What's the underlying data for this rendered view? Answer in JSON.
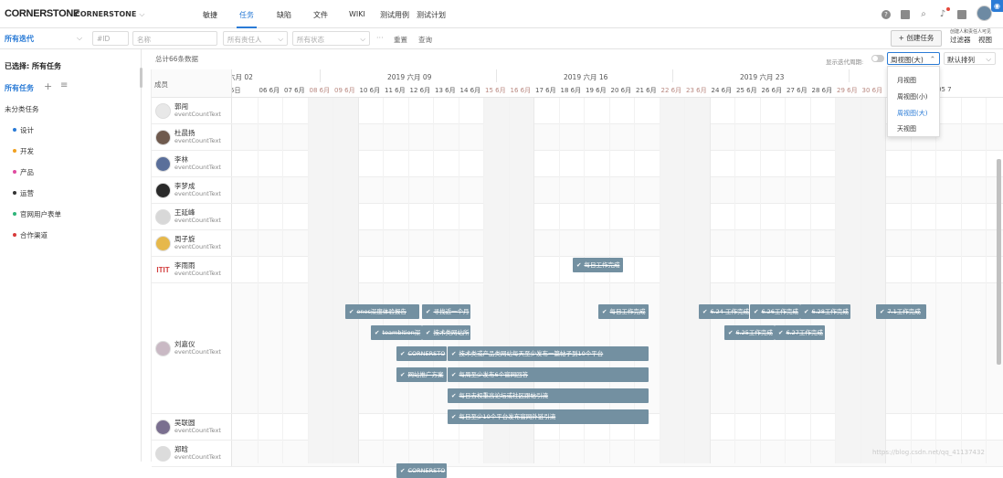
{
  "topbar": {
    "logo": "CORNERSTONE",
    "project": "CORNERSTONE",
    "nav": [
      "敏捷",
      "任务",
      "缺陷",
      "文件",
      "WIKI",
      "测试用例",
      "测试计划"
    ],
    "active_nav": "任务"
  },
  "filterbar": {
    "iteration": "所有迭代",
    "id_placeholder": "#ID",
    "name_placeholder": "名称",
    "owner_placeholder": "所有责任人",
    "status_placeholder": "所有状态",
    "more": "···",
    "reset": "重置",
    "search": "查询",
    "create_button": "+ 创建任务",
    "filter_hint": "创建人和责任人可见",
    "filter_label": "过滤器",
    "view_label": "视图"
  },
  "sidebar": {
    "selected_label": "已选择: ",
    "selected_value": "所有任务",
    "all_tasks": "所有任务",
    "uncategorized": "未分类任务",
    "categories": [
      {
        "label": "设计",
        "color": "#2a7bd6"
      },
      {
        "label": "开发",
        "color": "#f0a020"
      },
      {
        "label": "产品",
        "color": "#e04ba0"
      },
      {
        "label": "运营",
        "color": "#333333"
      },
      {
        "label": "官网用户表单",
        "color": "#2fb57a"
      },
      {
        "label": "合作渠道",
        "color": "#d83a3a"
      }
    ]
  },
  "main": {
    "total": "总计66条数据",
    "show_iteration": "显示迭代周期:",
    "view_selected": "周视图(大)",
    "sort_selected": "默认排列",
    "view_options": [
      "月视图",
      "周视图(小)",
      "周视图(大)",
      "天视图"
    ],
    "members_header": "成员",
    "weeks": [
      "六月 02",
      "2019 六月 09",
      "2019 六月 16",
      "2019 六月 23",
      "月 30"
    ],
    "days": [
      "5日",
      "06 6月",
      "07 6月",
      "08 6月",
      "09 6月",
      "10 6月",
      "11 6月",
      "12 6月",
      "13 6月",
      "14 6月",
      "15 6月",
      "16 6月",
      "17 6月",
      "18 6月",
      "19 6月",
      "20 6月",
      "21 6月",
      "22 6月",
      "23 6月",
      "24 6月",
      "25 6月",
      "26 6月",
      "27 6月",
      "28 6月",
      "29 6月",
      "30 6月",
      "01",
      "04 7月",
      "05 7"
    ],
    "members": [
      {
        "name": "郭闯",
        "sub": "eventCountText"
      },
      {
        "name": "杜晨扬",
        "sub": "eventCountText"
      },
      {
        "name": "李林",
        "sub": "eventCountText"
      },
      {
        "name": "李梦成",
        "sub": "eventCountText"
      },
      {
        "name": "王延峰",
        "sub": "eventCountText"
      },
      {
        "name": "周子旋",
        "sub": "eventCountText"
      },
      {
        "name": "李雨雨",
        "sub": "eventCountText",
        "avatar_text": "ITIT"
      },
      {
        "name": "刘嘉仪",
        "sub": "eventCountText"
      },
      {
        "name": "吴联圆",
        "sub": "eventCountText"
      },
      {
        "name": "郑晗",
        "sub": "eventCountText"
      }
    ],
    "tasks": [
      "每日工作完成",
      "ones深度体验报告",
      "寻找近一个月",
      "每日工作完成",
      "6.24 工作完成",
      "6.26工作完成",
      "6.28工作完成",
      "7.1工作完成",
      "teambition深",
      "技术类网站所",
      "6.25工作完成",
      "6.27工作完成",
      "CORNERSTO",
      "技术类或产品类网站每天至少发布一篇帖子到10个平台",
      "网站推广方案",
      "每周至少发布6个官网回答",
      "每日去权重高论坛或社区跟帖引流",
      "每日至少10个平台发布官网外链引流",
      "CORNERSTO"
    ]
  },
  "watermark": "https://blog.csdn.net/qq_41137432"
}
